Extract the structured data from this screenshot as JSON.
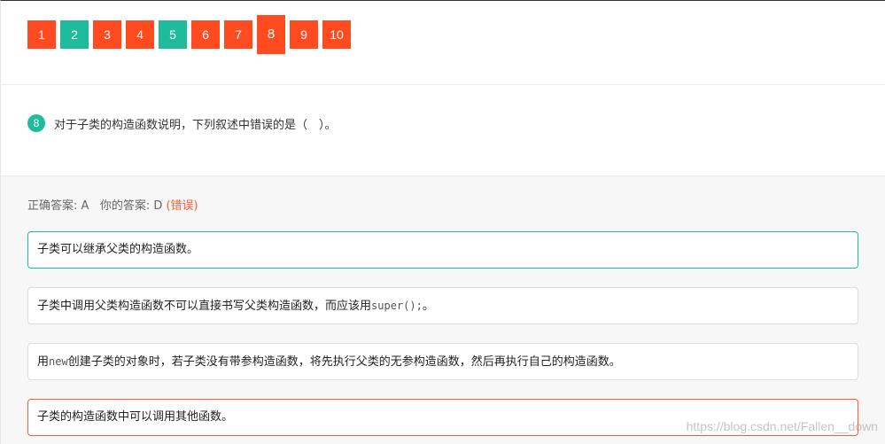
{
  "nav": {
    "buttons": [
      {
        "label": "1",
        "status": "wrong"
      },
      {
        "label": "2",
        "status": "right"
      },
      {
        "label": "3",
        "status": "wrong"
      },
      {
        "label": "4",
        "status": "wrong"
      },
      {
        "label": "5",
        "status": "right"
      },
      {
        "label": "6",
        "status": "wrong"
      },
      {
        "label": "7",
        "status": "wrong"
      },
      {
        "label": "8",
        "status": "wrong",
        "active": true
      },
      {
        "label": "9",
        "status": "wrong"
      },
      {
        "label": "10",
        "status": "wrong"
      }
    ]
  },
  "question": {
    "number": "8",
    "text": "对于子类的构造函数说明，下列叙述中错误的是（　）。"
  },
  "answer": {
    "correct_label": "正确答案: A",
    "your_label": "你的答案: D",
    "wrong_tag": "(错误)"
  },
  "options": [
    {
      "text_before": "子类可以继承父类的构造函数。",
      "code": "",
      "text_after": "",
      "state": "correct"
    },
    {
      "text_before": "子类中调用父类构造函数不可以直接书写父类构造函数，而应该用",
      "code": "super();",
      "text_after": "。",
      "state": "normal"
    },
    {
      "text_before": "用",
      "code": "new",
      "text_after": "创建子类的对象时，若子类没有带参构造函数，将先执行父类的无参构造函数，然后再执行自己的构造函数。",
      "state": "normal"
    },
    {
      "text_before": "子类的构造函数中可以调用其他函数。",
      "code": "",
      "text_after": "",
      "state": "incorrect"
    }
  ],
  "watermark": "https://blog.csdn.net/Fallen__down",
  "colors": {
    "wrong": "#ff4b1f",
    "right": "#1fbc9b"
  }
}
